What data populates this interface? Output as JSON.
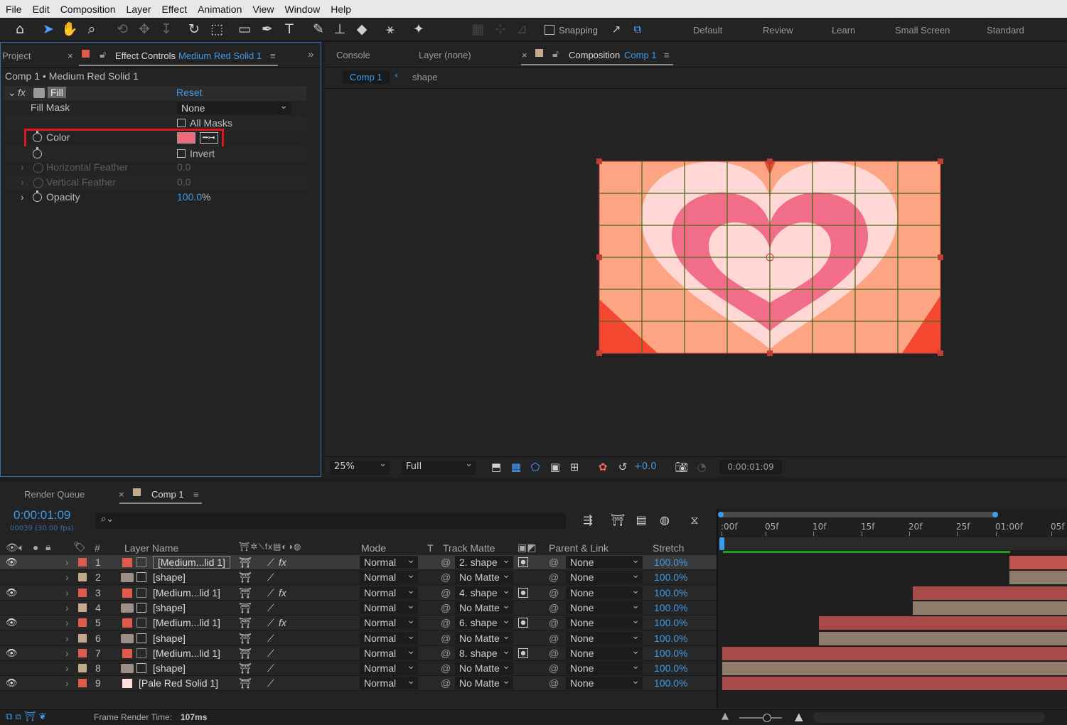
{
  "menu": [
    "File",
    "Edit",
    "Composition",
    "Layer",
    "Effect",
    "Animation",
    "View",
    "Window",
    "Help"
  ],
  "toolbar": {
    "snapping_label": "Snapping",
    "workspaces": [
      "Default",
      "Review",
      "Learn",
      "Small Screen",
      "Standard"
    ]
  },
  "left_panel": {
    "project_tab": "Project",
    "effect_tab": "Effect Controls",
    "effect_tab_layer": "Medium Red Solid 1",
    "breadcrumb": "Comp 1 • Medium Red Solid 1",
    "effect": {
      "name": "Fill",
      "reset": "Reset",
      "fill_mask_label": "Fill Mask",
      "fill_mask_value": "None",
      "all_masks": "All Masks",
      "color_label": "Color",
      "color_value": "#f0687e",
      "invert": "Invert",
      "h_feather": "Horizontal Feather",
      "h_feather_val": "0.0",
      "v_feather": "Vertical Feather",
      "v_feather_val": "0.0",
      "opacity": "Opacity",
      "opacity_val": "100.0",
      "opacity_unit": "%"
    }
  },
  "viewer": {
    "tabs": [
      "Console",
      "Layer (none)"
    ],
    "comp_tab": "Composition",
    "comp_tab_name": "Comp 1",
    "crumb_active": "Comp 1",
    "crumb_next": "shape",
    "zoom": "25%",
    "resolution": "Full",
    "exposure": "+0.0",
    "timecode": "0:00:01:09"
  },
  "timeline": {
    "render_queue": "Render Queue",
    "comp_tab": "Comp 1",
    "timecode": "0:00:01:09",
    "frame_info": "00039 (30.00 fps)",
    "search_placeholder": "",
    "headers": {
      "num": "#",
      "layer_name": "Layer Name",
      "mode": "Mode",
      "t": "T",
      "track_matte": "Track Matte",
      "parent": "Parent & Link",
      "stretch": "Stretch"
    },
    "ruler": [
      ":00f",
      "05f",
      "10f",
      "15f",
      "20f",
      "25f",
      "01:00f",
      "05f"
    ],
    "layers": [
      {
        "num": "1",
        "name": "[Medium...lid 1]",
        "label_color": "#e05a4e",
        "type": "solid",
        "mode": "Normal",
        "matte": "2. shape",
        "parent": "None",
        "stretch": "100.0%",
        "visible": true,
        "fx": true,
        "bar": "#c0534f",
        "start": 0.83
      },
      {
        "num": "2",
        "name": "[shape]",
        "label_color": "#c4a98c",
        "type": "shape",
        "mode": "Normal",
        "matte": "No Matte",
        "parent": "None",
        "stretch": "100.0%",
        "visible": false,
        "fx": false,
        "bar": "#8f7b69",
        "start": 0.83
      },
      {
        "num": "3",
        "name": "[Medium...lid 1]",
        "label_color": "#e05a4e",
        "type": "solid",
        "mode": "Normal",
        "matte": "4. shape",
        "parent": "None",
        "stretch": "100.0%",
        "visible": true,
        "fx": true,
        "bar": "#a84a48",
        "start": 0.55
      },
      {
        "num": "4",
        "name": "[shape]",
        "label_color": "#c4a98c",
        "type": "shape",
        "mode": "Normal",
        "matte": "No Matte",
        "parent": "None",
        "stretch": "100.0%",
        "visible": false,
        "fx": false,
        "bar": "#8f7b69",
        "start": 0.55
      },
      {
        "num": "5",
        "name": "[Medium...lid 1]",
        "label_color": "#e05a4e",
        "type": "solid",
        "mode": "Normal",
        "matte": "6. shape",
        "parent": "None",
        "stretch": "100.0%",
        "visible": true,
        "fx": true,
        "bar": "#a84a48",
        "start": 0.28
      },
      {
        "num": "6",
        "name": "[shape]",
        "label_color": "#c4a98c",
        "type": "shape",
        "mode": "Normal",
        "matte": "No Matte",
        "parent": "None",
        "stretch": "100.0%",
        "visible": false,
        "fx": false,
        "bar": "#8f7b69",
        "start": 0.28
      },
      {
        "num": "7",
        "name": "[Medium...lid 1]",
        "label_color": "#e05a4e",
        "type": "solid",
        "mode": "Normal",
        "matte": "8. shape",
        "parent": "None",
        "stretch": "100.0%",
        "visible": true,
        "fx": false,
        "bar": "#a84a48",
        "start": 0
      },
      {
        "num": "8",
        "name": "[shape]",
        "label_color": "#c4a98c",
        "type": "shape",
        "mode": "Normal",
        "matte": "No Matte",
        "parent": "None",
        "stretch": "100.0%",
        "visible": false,
        "fx": false,
        "bar": "#8f7b69",
        "start": 0
      },
      {
        "num": "9",
        "name": "[Pale Red Solid 1]",
        "label_color": "#e05a4e",
        "type": "pale",
        "mode": "Normal",
        "matte": "No Matte",
        "parent": "None",
        "stretch": "100.0%",
        "visible": true,
        "fx": false,
        "bar": "#a84a48",
        "start": 0
      }
    ]
  },
  "status": {
    "label": "Frame Render Time:",
    "value": "107ms"
  },
  "colors": {
    "accent": "#3d9be9",
    "heart_outer": "#ffd8d5",
    "heart_inner": "#f26d87",
    "bg": "#fda583",
    "corner": "#f4472f"
  }
}
